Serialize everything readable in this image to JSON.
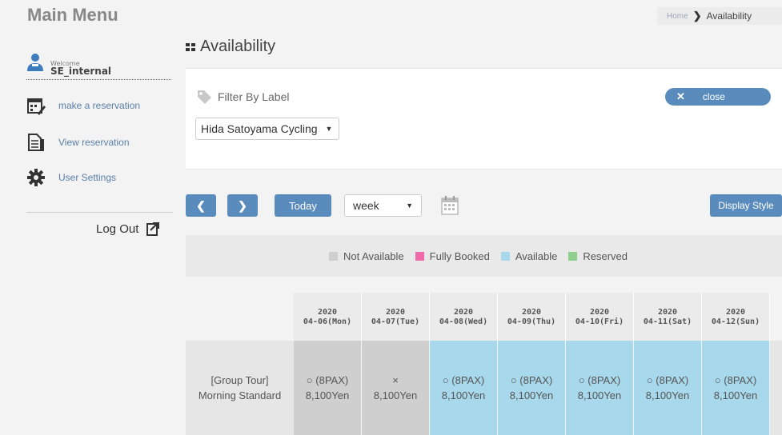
{
  "sidebar": {
    "title": "Main Menu",
    "welcome_text": "Welcome",
    "user_name": "SE_internal",
    "items": [
      {
        "label": "make a reservation",
        "icon": "calendar-edit-icon"
      },
      {
        "label": "View reservation",
        "icon": "document-icon"
      },
      {
        "label": "User Settings",
        "icon": "gear-icon"
      }
    ],
    "logout_label": "Log Out",
    "logout_icon": "logout-icon"
  },
  "breadcrumb": {
    "home": "Home",
    "separator": "❯",
    "current": "Availability"
  },
  "page": {
    "title": "Availability"
  },
  "filter": {
    "label": "Filter By Label",
    "selected": "Hida Satoyama Cycling",
    "close_label": "close",
    "close_x": "✕"
  },
  "toolbar": {
    "prev": "❮",
    "next": "❯",
    "today": "Today",
    "view_selected": "week",
    "display_style": "Display Style"
  },
  "legend": [
    {
      "label": "Not Available",
      "color": "#cfcfcf"
    },
    {
      "label": "Fully Booked",
      "color": "#f06aa8"
    },
    {
      "label": "Available",
      "color": "#a8d8ec"
    },
    {
      "label": "Reserved",
      "color": "#8fd08f"
    }
  ],
  "schedule": {
    "days": [
      {
        "year": "2020",
        "date": "04-06(Mon)"
      },
      {
        "year": "2020",
        "date": "04-07(Tue)"
      },
      {
        "year": "2020",
        "date": "04-08(Wed)"
      },
      {
        "year": "2020",
        "date": "04-09(Thu)"
      },
      {
        "year": "2020",
        "date": "04-10(Fri)"
      },
      {
        "year": "2020",
        "date": "04-11(Sat)"
      },
      {
        "year": "2020",
        "date": "04-12(Sun)"
      }
    ],
    "row": {
      "line1": "[Group Tour]",
      "line2": "Morning Standard",
      "slots": [
        {
          "status": "○ (8PAX)",
          "price": "8,100Yen",
          "state": "not-available"
        },
        {
          "status": "×",
          "price": "8,100Yen",
          "state": "not-available"
        },
        {
          "status": "○ (8PAX)",
          "price": "8,100Yen",
          "state": "available"
        },
        {
          "status": "○ (8PAX)",
          "price": "8,100Yen",
          "state": "available"
        },
        {
          "status": "○ (8PAX)",
          "price": "8,100Yen",
          "state": "available"
        },
        {
          "status": "○ (8PAX)",
          "price": "8,100Yen",
          "state": "available"
        },
        {
          "status": "○ (8PAX)",
          "price": "8,100Yen",
          "state": "available"
        }
      ]
    }
  }
}
